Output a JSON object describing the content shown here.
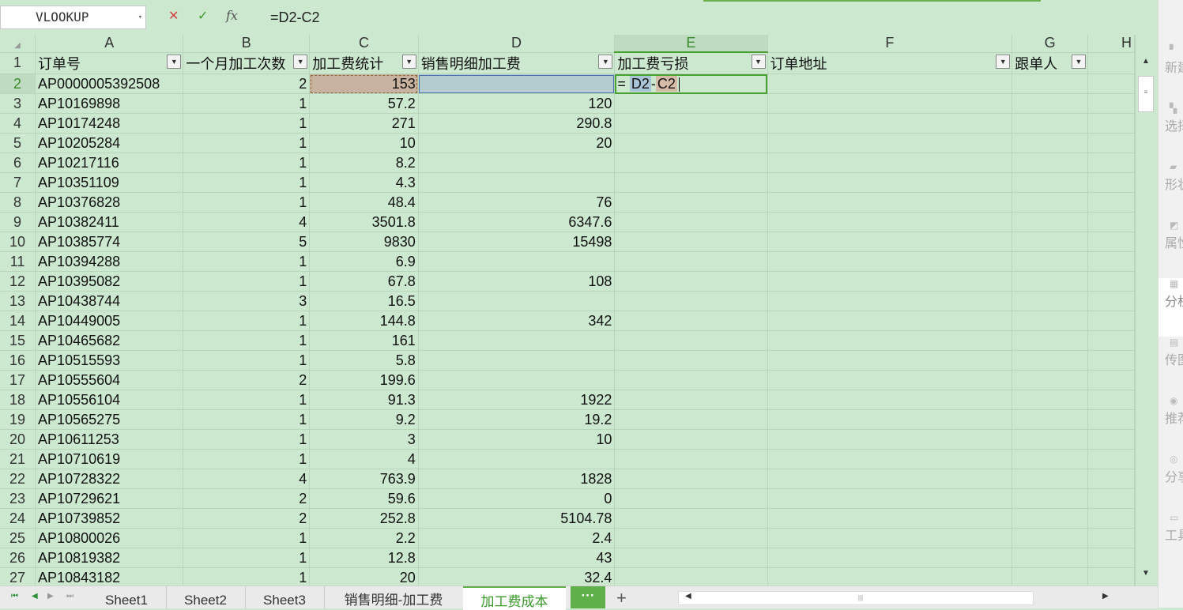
{
  "formula_bar": {
    "name_box": "VLOOKUP",
    "cancel_icon": "✕",
    "accept_icon": "✓",
    "fx_label": "fx",
    "formula": "=D2-C2"
  },
  "columns": [
    "A",
    "B",
    "C",
    "D",
    "E",
    "F",
    "G",
    "H"
  ],
  "headers": {
    "A": "订单号",
    "B": "一个月加工次数",
    "C": "加工费统计",
    "D": "销售明细加工费",
    "E": "加工费亏损",
    "F": "订单地址",
    "G": "跟单人"
  },
  "row_numbers": [
    "1",
    "2",
    "3",
    "4",
    "5",
    "6",
    "7",
    "8",
    "9",
    "10",
    "11",
    "12",
    "13",
    "14",
    "15",
    "16",
    "17",
    "18",
    "19",
    "20",
    "21",
    "22",
    "23",
    "24",
    "25",
    "26",
    "27"
  ],
  "rows": [
    {
      "a": "AP0000005392508",
      "b": "2",
      "c": "153",
      "d": ""
    },
    {
      "a": "AP10169898",
      "b": "1",
      "c": "57.2",
      "d": "120"
    },
    {
      "a": "AP10174248",
      "b": "1",
      "c": "271",
      "d": "290.8"
    },
    {
      "a": "AP10205284",
      "b": "1",
      "c": "10",
      "d": "20"
    },
    {
      "a": "AP10217116",
      "b": "1",
      "c": "8.2",
      "d": ""
    },
    {
      "a": "AP10351109",
      "b": "1",
      "c": "4.3",
      "d": ""
    },
    {
      "a": "AP10376828",
      "b": "1",
      "c": "48.4",
      "d": "76"
    },
    {
      "a": "AP10382411",
      "b": "4",
      "c": "3501.8",
      "d": "6347.6"
    },
    {
      "a": "AP10385774",
      "b": "5",
      "c": "9830",
      "d": "15498"
    },
    {
      "a": "AP10394288",
      "b": "1",
      "c": "6.9",
      "d": ""
    },
    {
      "a": "AP10395082",
      "b": "1",
      "c": "67.8",
      "d": "108"
    },
    {
      "a": "AP10438744",
      "b": "3",
      "c": "16.5",
      "d": ""
    },
    {
      "a": "AP10449005",
      "b": "1",
      "c": "144.8",
      "d": "342"
    },
    {
      "a": "AP10465682",
      "b": "1",
      "c": "161",
      "d": ""
    },
    {
      "a": "AP10515593",
      "b": "1",
      "c": "5.8",
      "d": ""
    },
    {
      "a": "AP10555604",
      "b": "2",
      "c": "199.6",
      "d": ""
    },
    {
      "a": "AP10556104",
      "b": "1",
      "c": "91.3",
      "d": "1922"
    },
    {
      "a": "AP10565275",
      "b": "1",
      "c": "9.2",
      "d": "19.2"
    },
    {
      "a": "AP10611253",
      "b": "1",
      "c": "3",
      "d": "10"
    },
    {
      "a": "AP10710619",
      "b": "1",
      "c": "4",
      "d": ""
    },
    {
      "a": "AP10728322",
      "b": "4",
      "c": "763.9",
      "d": "1828"
    },
    {
      "a": "AP10729621",
      "b": "2",
      "c": "59.6",
      "d": "0"
    },
    {
      "a": "AP10739852",
      "b": "2",
      "c": "252.8",
      "d": "5104.78"
    },
    {
      "a": "AP10800026",
      "b": "1",
      "c": "2.2",
      "d": "2.4"
    },
    {
      "a": "AP10819382",
      "b": "1",
      "c": "12.8",
      "d": "43"
    },
    {
      "a": "AP10843182",
      "b": "1",
      "c": "20",
      "d": "32.4"
    }
  ],
  "edit_cell": {
    "eq": "=",
    "ref1": "D2",
    "minus": "-",
    "ref2": "C2"
  },
  "sheet_tabs": [
    "Sheet1",
    "Sheet2",
    "Sheet3",
    "销售明细-加工费",
    "加工费成本"
  ],
  "active_tab": "加工费成本",
  "more_label": "···",
  "add_label": "+",
  "right_panel": [
    "新建",
    "选择",
    "形状",
    "属性",
    "分析",
    "传图",
    "推荐",
    "分享",
    "工具"
  ],
  "colors": {
    "sheet_bg": "#cce8cf",
    "accent": "#5fb04a",
    "ref_c": "#c8b3a1",
    "ref_d": "#b4ccd0"
  }
}
